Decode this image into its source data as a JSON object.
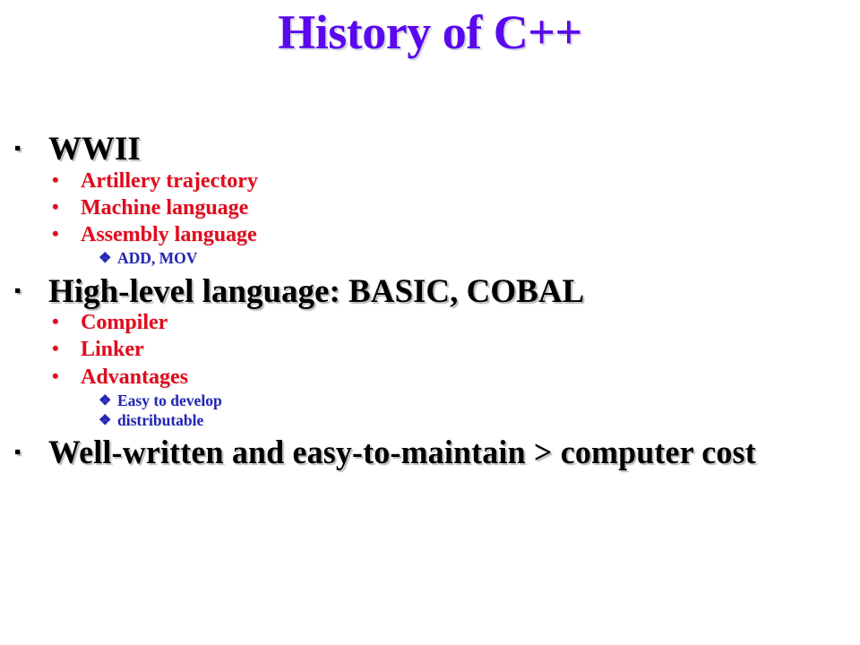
{
  "slide": {
    "title": "History of C++",
    "title_color": "#5A09EE",
    "background_color": "#FFFFFF",
    "level_colors": {
      "level1": "#000000",
      "level2": "#E00C1E",
      "level3": "#2226B4"
    },
    "bullet_glyphs": {
      "level1": "▪",
      "level2": "•",
      "level3": "❖"
    },
    "bullets": [
      {
        "level": 1,
        "marker": "▪",
        "text": "WWII"
      },
      {
        "level": 2,
        "marker": "•",
        "text": "Artillery trajectory"
      },
      {
        "level": 2,
        "marker": "•",
        "text": "Machine language"
      },
      {
        "level": 2,
        "marker": "•",
        "text": "Assembly language"
      },
      {
        "level": 3,
        "marker": "❖",
        "text": "ADD, MOV"
      },
      {
        "level": 1,
        "marker": "▪",
        "text": "High-level language: BASIC, COBAL"
      },
      {
        "level": 2,
        "marker": "•",
        "text": "Compiler"
      },
      {
        "level": 2,
        "marker": "•",
        "text": "Linker"
      },
      {
        "level": 2,
        "marker": "•",
        "text": "Advantages"
      },
      {
        "level": 3,
        "marker": "❖",
        "text": "Easy to develop"
      },
      {
        "level": 3,
        "marker": "❖",
        "text": "distributable"
      },
      {
        "level": 1,
        "marker": "▪",
        "text": "Well-written and easy-to-maintain > computer cost"
      }
    ]
  }
}
